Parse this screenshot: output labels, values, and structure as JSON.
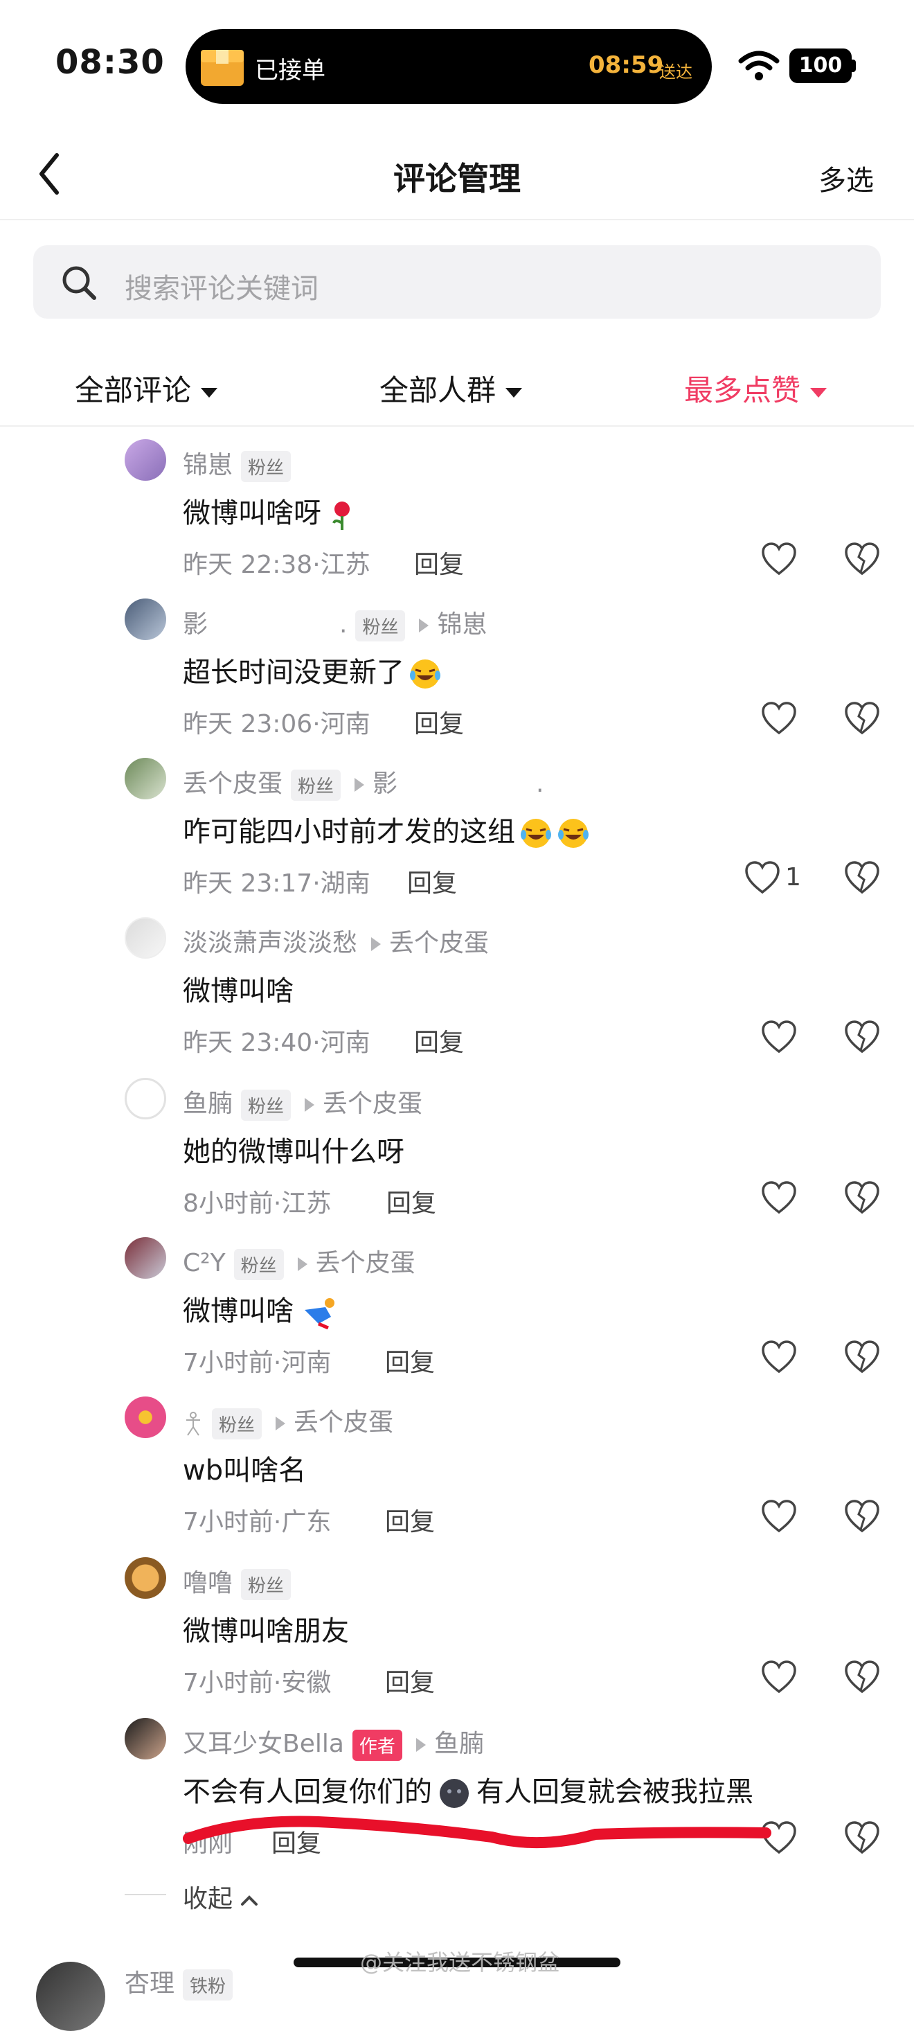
{
  "status_bar": {
    "time": "08:30",
    "island_label": "已接单",
    "island_time": "08:59",
    "island_suffix": "送达",
    "battery": "100"
  },
  "nav": {
    "title": "评论管理",
    "multi_select": "多选"
  },
  "search": {
    "placeholder": "搜索评论关键词"
  },
  "filters": [
    {
      "label": "全部评论"
    },
    {
      "label": "全部人群"
    },
    {
      "label": "最多点赞",
      "active": true
    }
  ],
  "comments": [
    {
      "user": "锦崽",
      "badge": "粉丝",
      "text": "微博叫啥呀",
      "time": "昨天 22:38·江苏",
      "reply": "回复"
    },
    {
      "user": "影",
      "user_suffix": ".",
      "badge": "粉丝",
      "reply_to": "锦崽",
      "text": "超长时间没更新了",
      "time": "昨天 23:06·河南",
      "reply": "回复"
    },
    {
      "user": "丢个皮蛋",
      "badge": "粉丝",
      "reply_to": "影",
      "reply_to_suffix": ".",
      "text": "咋可能四小时前才发的这组",
      "time": "昨天 23:17·湖南",
      "reply": "回复",
      "likes": "1"
    },
    {
      "user": "淡淡萧声淡淡愁",
      "reply_to": "丢个皮蛋",
      "text": "微博叫啥",
      "time": "昨天 23:40·河南",
      "reply": "回复"
    },
    {
      "user": "鱼腩",
      "badge": "粉丝",
      "reply_to": "丢个皮蛋",
      "text": "她的微博叫什么呀",
      "time": "8小时前·江苏",
      "reply": "回复"
    },
    {
      "user": "C²Y",
      "badge": "粉丝",
      "reply_to": "丢个皮蛋",
      "text": "微博叫啥",
      "time": "7小时前·河南",
      "reply": "回复"
    },
    {
      "user": "",
      "badge": "粉丝",
      "reply_to": "丢个皮蛋",
      "text": "wb叫啥名",
      "time": "7小时前·广东",
      "reply": "回复"
    },
    {
      "user": "噜噜",
      "badge": "粉丝",
      "text": "微博叫啥朋友",
      "time": "7小时前·安徽",
      "reply": "回复"
    },
    {
      "user": "又耳少女Bella",
      "author_badge": "作者",
      "reply_to": "鱼腩",
      "text_before": "不会有人回复你们的",
      "text_after": "有人回复就会被我拉黑",
      "time": "刚刚",
      "reply": "回复"
    }
  ],
  "collapse": "收起",
  "next_comment": {
    "user": "杏理",
    "badge": "铁粉"
  },
  "watermark": "@关注我送不锈钢盆",
  "colors": {
    "accent": "#f03c63",
    "island_time": "#f4b33b",
    "annotation": "#e8102a"
  }
}
